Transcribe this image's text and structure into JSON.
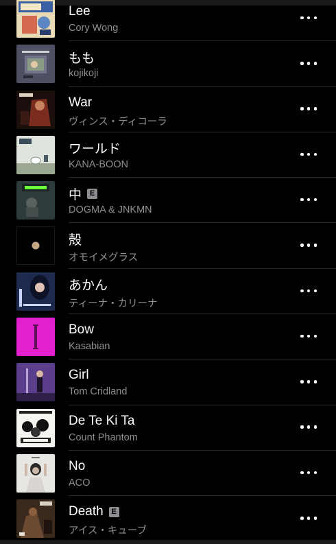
{
  "songs": [
    {
      "title": "Lee",
      "artist": "Cory Wong",
      "explicit": false,
      "art_icon": "cory-wong-album-art"
    },
    {
      "title": "もも",
      "artist": "kojikoji",
      "explicit": false,
      "art_icon": "kojikoji-album-art"
    },
    {
      "title": "War",
      "artist": "ヴィンス・ディコーラ",
      "explicit": false,
      "art_icon": "rocky-iv-album-art"
    },
    {
      "title": "ワールド",
      "artist": "KANA-BOON",
      "explicit": false,
      "art_icon": "kana-boon-album-art"
    },
    {
      "title": "中",
      "artist": "DOGMA & JNKMN",
      "explicit": true,
      "art_icon": "darc-album-art"
    },
    {
      "title": "殻",
      "artist": "オモイメグラス",
      "explicit": false,
      "art_icon": "moon-album-art"
    },
    {
      "title": "あかん",
      "artist": "ティーナ・カリーナ",
      "explicit": false,
      "art_icon": "tina-karina-album-art"
    },
    {
      "title": "Bow",
      "artist": "Kasabian",
      "explicit": false,
      "art_icon": "kasabian-album-art"
    },
    {
      "title": "Girl",
      "artist": "Tom Cridland",
      "explicit": false,
      "art_icon": "tom-cridland-album-art"
    },
    {
      "title": "De Te Ki Ta",
      "artist": "Count Phantom",
      "explicit": false,
      "art_icon": "count-phantom-album-art"
    },
    {
      "title": "No",
      "artist": "ACO",
      "explicit": false,
      "art_icon": "aco-album-art"
    },
    {
      "title": "Death",
      "artist": "アイス・キューブ",
      "explicit": true,
      "art_icon": "ice-cube-album-art"
    }
  ],
  "explicit_badge": "E",
  "more_icon": "ellipsis-icon",
  "colors": {
    "background": "#000000",
    "title": "#ffffff",
    "subtitle": "#8e8e93",
    "separator": "#2a2a2c",
    "explicit_badge": "#8e8e93"
  }
}
